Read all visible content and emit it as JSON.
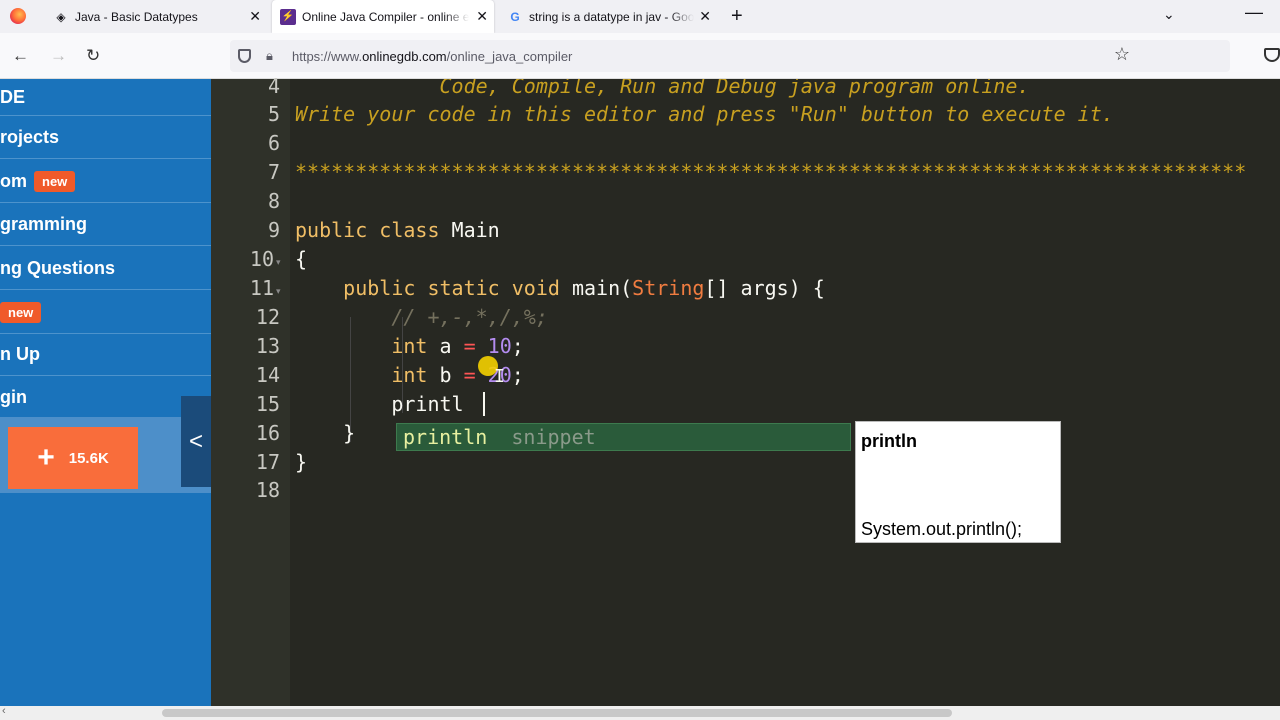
{
  "browser": {
    "tabs": [
      {
        "title": "Java - Basic Datatypes",
        "icon": "tutorialspoint-icon",
        "active": false
      },
      {
        "title": "Online Java Compiler - online e",
        "icon": "onlinegdb-icon",
        "active": true
      },
      {
        "title": "string is a datatype in jav - Goo",
        "icon": "google-icon",
        "active": false
      }
    ],
    "url_prefix": "https://www.",
    "url_domain": "onlinegdb.com",
    "url_path": "/online_java_compiler"
  },
  "sidebar": {
    "items": [
      {
        "label": "DE"
      },
      {
        "label": "rojects"
      },
      {
        "label": "om",
        "badge": "new"
      },
      {
        "label": "gramming"
      },
      {
        "label": "ng Questions"
      },
      {
        "label": "",
        "badge": "new"
      },
      {
        "label": "n Up"
      },
      {
        "label": "gin"
      }
    ],
    "share_count": "15.6K",
    "collapse_icon": "chevron-left-icon"
  },
  "editor": {
    "line_numbers": [
      "4",
      "5",
      "6",
      "7",
      "8",
      "9",
      "10",
      "11",
      "12",
      "13",
      "14",
      "15",
      "16",
      "17",
      "18"
    ],
    "lines": {
      "l4": "            Code, Compile, Run and Debug java program online.",
      "l5": "Write your code in this editor and press \"Run\" button to execute it.",
      "l7": "*******************************************************************************",
      "l9_kw": "public class",
      "l9_name": " Main",
      "l10": "{",
      "l11_kw": "    public static void",
      "l11_name": " main(",
      "l11_type": "String",
      "l11_rest": "[] args) {",
      "l12": "        // +,-,*,/,%;",
      "l13_kw": "        int",
      "l13_var": " a ",
      "l13_op": "=",
      "l13_num": " 10",
      "l13_end": ";",
      "l14_kw": "        int",
      "l14_var": " b ",
      "l14_op": "=",
      "l14_num": " 20",
      "l14_end": ";",
      "l15": "        printl",
      "l16": "    }",
      "l17": "}"
    },
    "autocomplete": {
      "match": "println",
      "meta": "snippet",
      "doc_title": "println",
      "doc_body": "System.out.println();"
    }
  },
  "colors": {
    "sidebar_bg": "#1a73bb",
    "badge": "#f05a2a",
    "share_button": "#f96d3b",
    "editor_bg": "#272822"
  }
}
